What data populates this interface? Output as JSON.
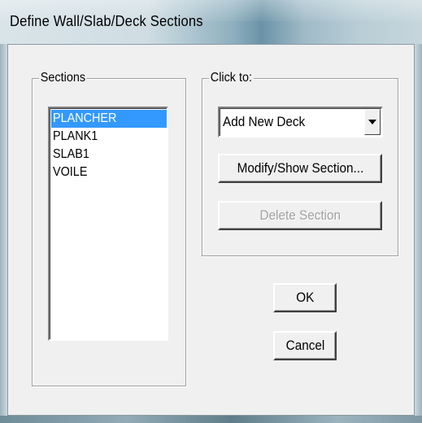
{
  "window": {
    "title": "Define Wall/Slab/Deck Sections"
  },
  "sections_group": {
    "label": "Sections",
    "items": [
      {
        "label": "PLANCHER",
        "selected": true
      },
      {
        "label": "PLANK1",
        "selected": false
      },
      {
        "label": "SLAB1",
        "selected": false
      },
      {
        "label": "VOILE",
        "selected": false
      }
    ]
  },
  "click_to_group": {
    "label": "Click to:",
    "add_dropdown": {
      "selected": "Add New Deck"
    },
    "modify_button": "Modify/Show Section...",
    "delete_button": "Delete Section"
  },
  "buttons": {
    "ok": "OK",
    "cancel": "Cancel"
  },
  "colors": {
    "selection": "#3399ff",
    "face": "#f0f0f0",
    "disabled_text": "#a0a0a0"
  }
}
